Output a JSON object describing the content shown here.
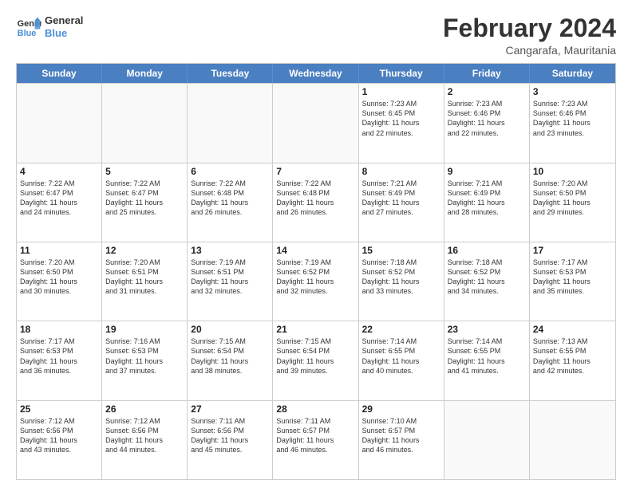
{
  "header": {
    "logo_line1": "General",
    "logo_line2": "Blue",
    "month_title": "February 2024",
    "location": "Cangarafa, Mauritania"
  },
  "weekdays": [
    "Sunday",
    "Monday",
    "Tuesday",
    "Wednesday",
    "Thursday",
    "Friday",
    "Saturday"
  ],
  "weeks": [
    [
      {
        "day": "",
        "info": ""
      },
      {
        "day": "",
        "info": ""
      },
      {
        "day": "",
        "info": ""
      },
      {
        "day": "",
        "info": ""
      },
      {
        "day": "1",
        "info": "Sunrise: 7:23 AM\nSunset: 6:45 PM\nDaylight: 11 hours\nand 22 minutes."
      },
      {
        "day": "2",
        "info": "Sunrise: 7:23 AM\nSunset: 6:46 PM\nDaylight: 11 hours\nand 22 minutes."
      },
      {
        "day": "3",
        "info": "Sunrise: 7:23 AM\nSunset: 6:46 PM\nDaylight: 11 hours\nand 23 minutes."
      }
    ],
    [
      {
        "day": "4",
        "info": "Sunrise: 7:22 AM\nSunset: 6:47 PM\nDaylight: 11 hours\nand 24 minutes."
      },
      {
        "day": "5",
        "info": "Sunrise: 7:22 AM\nSunset: 6:47 PM\nDaylight: 11 hours\nand 25 minutes."
      },
      {
        "day": "6",
        "info": "Sunrise: 7:22 AM\nSunset: 6:48 PM\nDaylight: 11 hours\nand 26 minutes."
      },
      {
        "day": "7",
        "info": "Sunrise: 7:22 AM\nSunset: 6:48 PM\nDaylight: 11 hours\nand 26 minutes."
      },
      {
        "day": "8",
        "info": "Sunrise: 7:21 AM\nSunset: 6:49 PM\nDaylight: 11 hours\nand 27 minutes."
      },
      {
        "day": "9",
        "info": "Sunrise: 7:21 AM\nSunset: 6:49 PM\nDaylight: 11 hours\nand 28 minutes."
      },
      {
        "day": "10",
        "info": "Sunrise: 7:20 AM\nSunset: 6:50 PM\nDaylight: 11 hours\nand 29 minutes."
      }
    ],
    [
      {
        "day": "11",
        "info": "Sunrise: 7:20 AM\nSunset: 6:50 PM\nDaylight: 11 hours\nand 30 minutes."
      },
      {
        "day": "12",
        "info": "Sunrise: 7:20 AM\nSunset: 6:51 PM\nDaylight: 11 hours\nand 31 minutes."
      },
      {
        "day": "13",
        "info": "Sunrise: 7:19 AM\nSunset: 6:51 PM\nDaylight: 11 hours\nand 32 minutes."
      },
      {
        "day": "14",
        "info": "Sunrise: 7:19 AM\nSunset: 6:52 PM\nDaylight: 11 hours\nand 32 minutes."
      },
      {
        "day": "15",
        "info": "Sunrise: 7:18 AM\nSunset: 6:52 PM\nDaylight: 11 hours\nand 33 minutes."
      },
      {
        "day": "16",
        "info": "Sunrise: 7:18 AM\nSunset: 6:52 PM\nDaylight: 11 hours\nand 34 minutes."
      },
      {
        "day": "17",
        "info": "Sunrise: 7:17 AM\nSunset: 6:53 PM\nDaylight: 11 hours\nand 35 minutes."
      }
    ],
    [
      {
        "day": "18",
        "info": "Sunrise: 7:17 AM\nSunset: 6:53 PM\nDaylight: 11 hours\nand 36 minutes."
      },
      {
        "day": "19",
        "info": "Sunrise: 7:16 AM\nSunset: 6:53 PM\nDaylight: 11 hours\nand 37 minutes."
      },
      {
        "day": "20",
        "info": "Sunrise: 7:15 AM\nSunset: 6:54 PM\nDaylight: 11 hours\nand 38 minutes."
      },
      {
        "day": "21",
        "info": "Sunrise: 7:15 AM\nSunset: 6:54 PM\nDaylight: 11 hours\nand 39 minutes."
      },
      {
        "day": "22",
        "info": "Sunrise: 7:14 AM\nSunset: 6:55 PM\nDaylight: 11 hours\nand 40 minutes."
      },
      {
        "day": "23",
        "info": "Sunrise: 7:14 AM\nSunset: 6:55 PM\nDaylight: 11 hours\nand 41 minutes."
      },
      {
        "day": "24",
        "info": "Sunrise: 7:13 AM\nSunset: 6:55 PM\nDaylight: 11 hours\nand 42 minutes."
      }
    ],
    [
      {
        "day": "25",
        "info": "Sunrise: 7:12 AM\nSunset: 6:56 PM\nDaylight: 11 hours\nand 43 minutes."
      },
      {
        "day": "26",
        "info": "Sunrise: 7:12 AM\nSunset: 6:56 PM\nDaylight: 11 hours\nand 44 minutes."
      },
      {
        "day": "27",
        "info": "Sunrise: 7:11 AM\nSunset: 6:56 PM\nDaylight: 11 hours\nand 45 minutes."
      },
      {
        "day": "28",
        "info": "Sunrise: 7:11 AM\nSunset: 6:57 PM\nDaylight: 11 hours\nand 46 minutes."
      },
      {
        "day": "29",
        "info": "Sunrise: 7:10 AM\nSunset: 6:57 PM\nDaylight: 11 hours\nand 46 minutes."
      },
      {
        "day": "",
        "info": ""
      },
      {
        "day": "",
        "info": ""
      }
    ]
  ]
}
